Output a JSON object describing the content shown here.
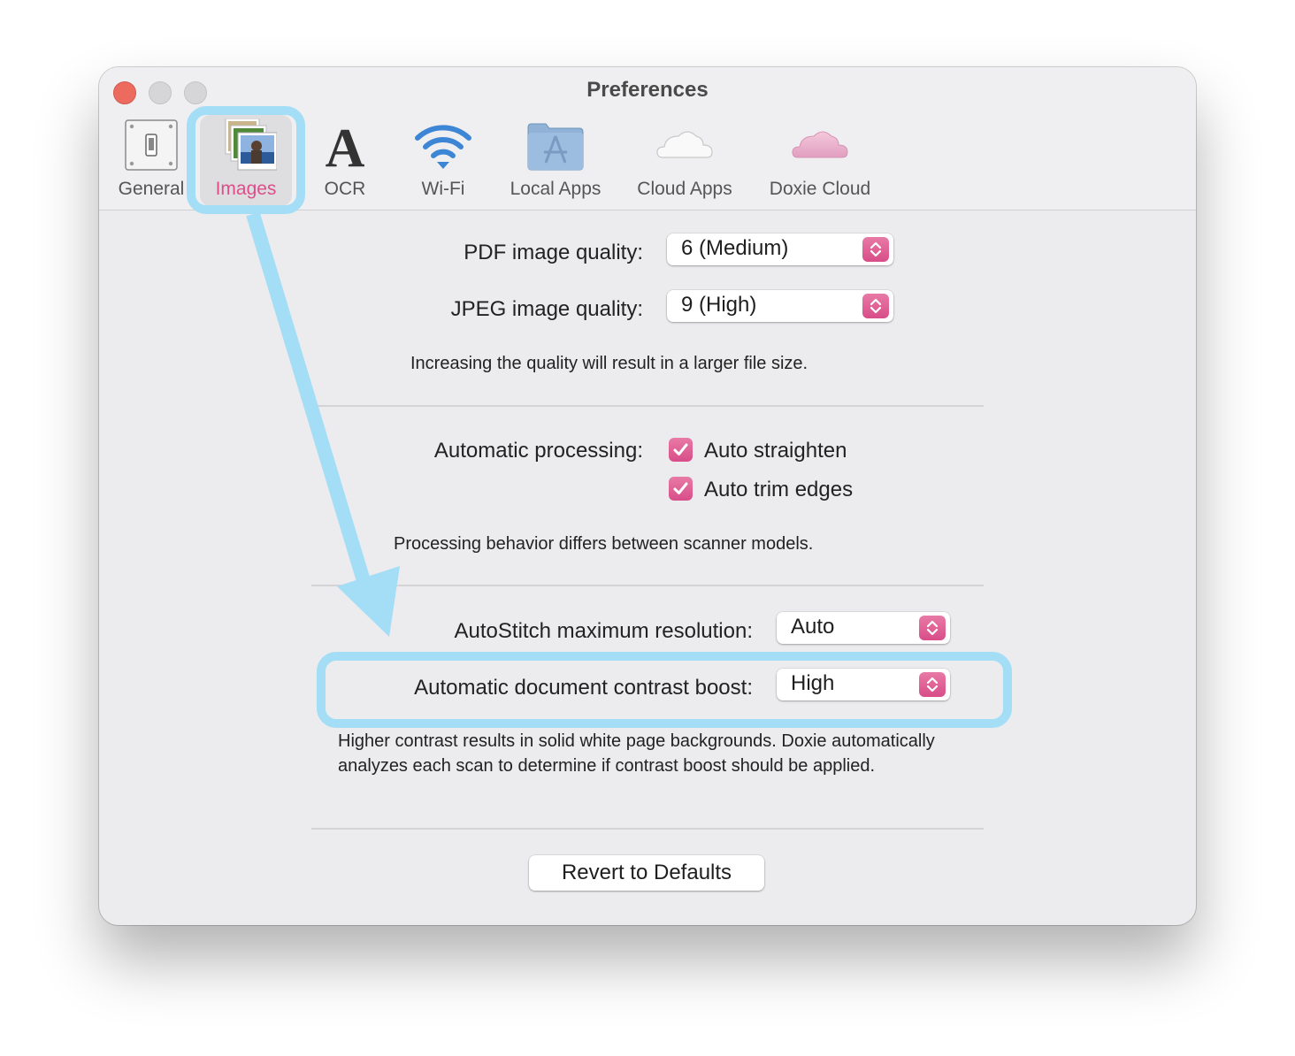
{
  "window": {
    "title": "Preferences",
    "traffic_lights": [
      "close",
      "minimize",
      "zoom"
    ]
  },
  "toolbar": {
    "tabs": [
      {
        "label": "General",
        "icon": "light-switch-icon",
        "active": false
      },
      {
        "label": "Images",
        "icon": "photo-stack-icon",
        "active": true
      },
      {
        "label": "OCR",
        "icon": "letter-a-icon",
        "active": false
      },
      {
        "label": "Wi-Fi",
        "icon": "wifi-icon",
        "active": false
      },
      {
        "label": "Local Apps",
        "icon": "applications-folder-icon",
        "active": false
      },
      {
        "label": "Cloud Apps",
        "icon": "white-cloud-icon",
        "active": false
      },
      {
        "label": "Doxie Cloud",
        "icon": "pink-cloud-icon",
        "active": false
      }
    ]
  },
  "quality": {
    "pdf_label": "PDF image quality:",
    "pdf_value": "6 (Medium)",
    "jpeg_label": "JPEG image quality:",
    "jpeg_value": "9 (High)",
    "note": "Increasing the quality will result in a larger file size."
  },
  "processing": {
    "label": "Automatic processing:",
    "options": [
      {
        "label": "Auto straighten",
        "checked": true
      },
      {
        "label": "Auto trim edges",
        "checked": true
      }
    ],
    "note": "Processing behavior differs between scanner models."
  },
  "advanced": {
    "autostitch_label": "AutoStitch maximum resolution:",
    "autostitch_value": "Auto",
    "contrast_label": "Automatic document contrast boost:",
    "contrast_value": "High",
    "note": "Higher contrast results in solid white page backgrounds. Doxie automatically analyzes each scan to determine if contrast boost should be applied."
  },
  "footer": {
    "revert_label": "Revert to Defaults"
  },
  "colors": {
    "accent": "#df4d8a",
    "annotation": "#a4def6"
  }
}
